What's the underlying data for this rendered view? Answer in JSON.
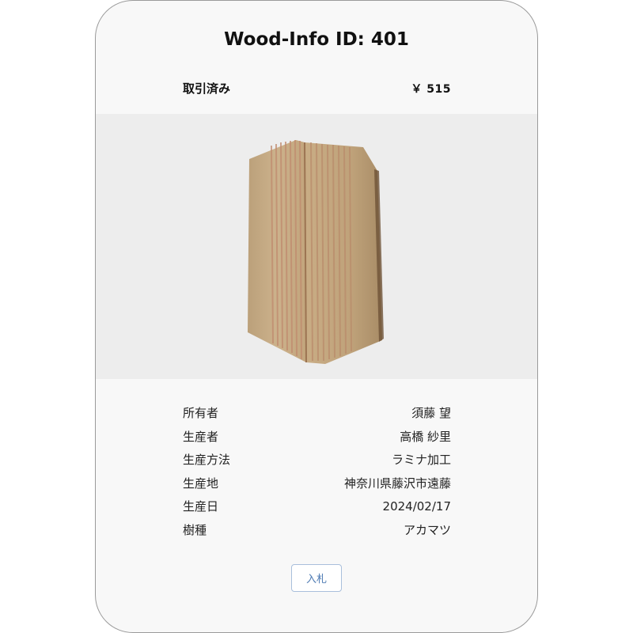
{
  "card": {
    "title": "Wood-Info ID: 401",
    "status": "取引済み",
    "price": "￥ 515"
  },
  "image": {
    "alt": "wood-laminated-block"
  },
  "details": [
    {
      "label": "所有者",
      "value": "須藤 望"
    },
    {
      "label": "生産者",
      "value": "高橋 紗里"
    },
    {
      "label": "生産方法",
      "value": "ラミナ加工"
    },
    {
      "label": "生産地",
      "value": "神奈川県藤沢市遠藤"
    },
    {
      "label": "生産日",
      "value": "2024/02/17"
    },
    {
      "label": "樹種",
      "value": "アカマツ"
    }
  ],
  "actions": {
    "bid_label": "入札"
  },
  "colors": {
    "card_background": "#f8f8f8",
    "image_background": "#ededed",
    "button_text": "#4d7ab3",
    "button_border": "#a9bfdc"
  }
}
